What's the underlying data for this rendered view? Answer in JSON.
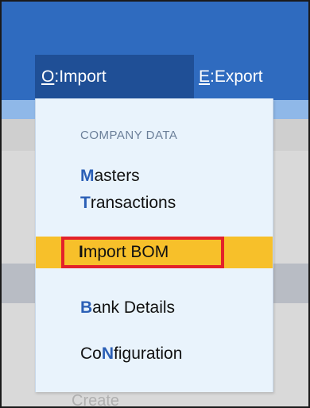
{
  "menubar": {
    "import_key": "O",
    "import_sep": ":",
    "import_label": " Import",
    "export_key": "E",
    "export_sep": ":",
    "export_label": " Export"
  },
  "dropdown": {
    "section_header": "COMPANY DATA",
    "items": [
      {
        "key": "M",
        "rest": "asters"
      },
      {
        "key": "T",
        "rest": "ransactions"
      },
      {
        "key": "I",
        "rest": "mport BOM"
      },
      {
        "key": "B",
        "rest": "ank Details"
      },
      {
        "pre": "Co",
        "key": "N",
        "rest": "figuration"
      }
    ]
  },
  "background": {
    "partial_text": "Create"
  },
  "colors": {
    "header_blue": "#2f6bbf",
    "active_tab": "#1f4f96",
    "menu_bg": "#e9f3fc",
    "highlight": "#f7c02a",
    "annotation_red": "#e3222a",
    "hotkey_blue": "#2b5fb6"
  }
}
